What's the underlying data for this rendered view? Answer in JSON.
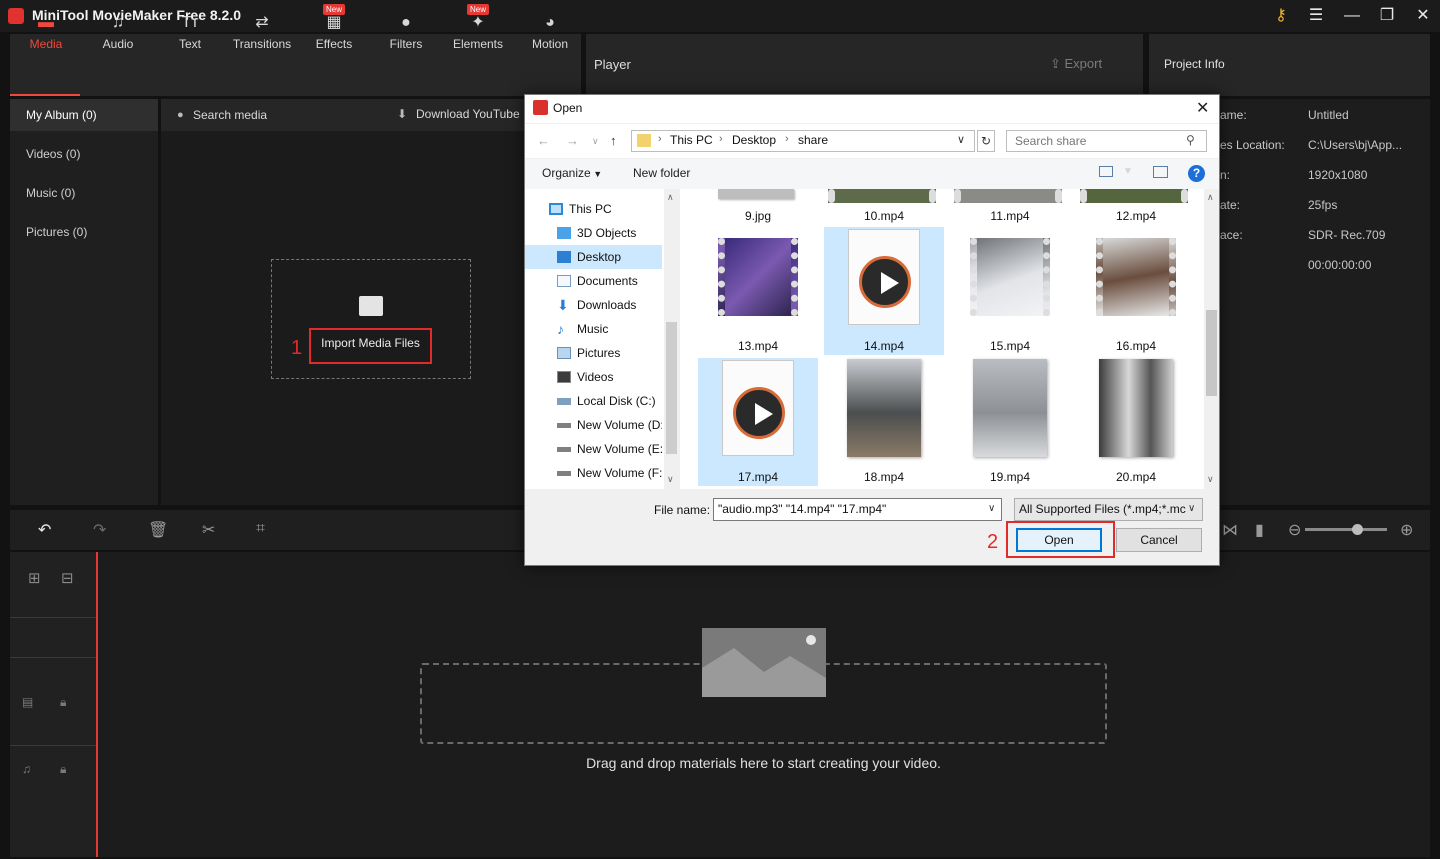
{
  "app": {
    "title": "MiniTool MovieMaker Free 8.2.0"
  },
  "toolbar": {
    "items": [
      {
        "label": "Media",
        "icon": "media-icon",
        "badge": ""
      },
      {
        "label": "Audio",
        "icon": "music-note-icon",
        "badge": ""
      },
      {
        "label": "Text",
        "icon": "text-icon",
        "badge": ""
      },
      {
        "label": "Transitions",
        "icon": "transitions-icon",
        "badge": ""
      },
      {
        "label": "Effects",
        "icon": "effects-icon",
        "badge": "New"
      },
      {
        "label": "Filters",
        "icon": "filters-icon",
        "badge": ""
      },
      {
        "label": "Elements",
        "icon": "elements-icon",
        "badge": "New"
      },
      {
        "label": "Motion",
        "icon": "motion-icon",
        "badge": ""
      }
    ]
  },
  "player": {
    "title": "Player",
    "export_label": "Export"
  },
  "project_info": {
    "title": "Project Info",
    "rows": [
      {
        "label": "ame:",
        "value": "Untitled"
      },
      {
        "label": "es Location:",
        "value": "C:\\Users\\bj\\App..."
      },
      {
        "label": "n:",
        "value": "1920x1080"
      },
      {
        "label": "ate:",
        "value": "25fps"
      },
      {
        "label": "ace:",
        "value": "SDR- Rec.709"
      },
      {
        "label": "",
        "value": "00:00:00:00"
      }
    ]
  },
  "sidebar": {
    "items": [
      {
        "label": "My Album (0)"
      },
      {
        "label": "Videos (0)"
      },
      {
        "label": "Music (0)"
      },
      {
        "label": "Pictures (0)"
      }
    ]
  },
  "media": {
    "search_label": "Search media",
    "download_label": "Download YouTube",
    "import_label": "Import Media Files",
    "callout": "1"
  },
  "timeline": {
    "drop_text": "Drag and drop materials here to start creating your video."
  },
  "dialog": {
    "title": "Open",
    "breadcrumb": [
      "This PC",
      "Desktop",
      "share"
    ],
    "search_placeholder": "Search share",
    "organize_label": "Organize",
    "new_folder_label": "New folder",
    "nav_items": [
      {
        "label": "This PC",
        "icon": "computer-icon"
      },
      {
        "label": "3D Objects",
        "icon": "cube-icon"
      },
      {
        "label": "Desktop",
        "icon": "desktop-icon"
      },
      {
        "label": "Documents",
        "icon": "document-icon"
      },
      {
        "label": "Downloads",
        "icon": "download-arrow-icon"
      },
      {
        "label": "Music",
        "icon": "music-note-icon"
      },
      {
        "label": "Pictures",
        "icon": "picture-icon"
      },
      {
        "label": "Videos",
        "icon": "film-icon"
      },
      {
        "label": "Local Disk (C:)",
        "icon": "drive-icon"
      },
      {
        "label": "New Volume (D:",
        "icon": "drive-icon"
      },
      {
        "label": "New Volume (E:)",
        "icon": "drive-icon"
      },
      {
        "label": "New Volume (F:)",
        "icon": "drive-icon"
      }
    ],
    "files_top": [
      "9.jpg",
      "10.mp4",
      "11.mp4",
      "12.mp4"
    ],
    "files": [
      {
        "name": "13.mp4",
        "kind": "film",
        "color": "#4a3a8a"
      },
      {
        "name": "14.mp4",
        "kind": "doc",
        "color": "#ffffff"
      },
      {
        "name": "15.mp4",
        "kind": "film",
        "color": "#c4c7cc"
      },
      {
        "name": "16.mp4",
        "kind": "film",
        "color": "#6f5a4a"
      },
      {
        "name": "17.mp4",
        "kind": "doc",
        "color": "#ffffff"
      },
      {
        "name": "18.mp4",
        "kind": "photo",
        "color": "#8c8f94"
      },
      {
        "name": "19.mp4",
        "kind": "photo",
        "color": "#a9adb3"
      },
      {
        "name": "20.mp4",
        "kind": "photo",
        "color": "#7d7f82"
      }
    ],
    "file_name_label": "File name:",
    "file_name_value": "\"audio.mp3\" \"14.mp4\" \"17.mp4\"",
    "file_type": "All Supported Files (*.mp4;*.mc",
    "open_label": "Open",
    "cancel_label": "Cancel",
    "callout": "2"
  }
}
